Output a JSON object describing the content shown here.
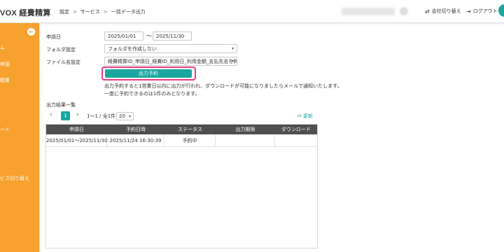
{
  "header": {
    "logo_text": "VOX",
    "logo_sub": "経費精算",
    "breadcrumbs": [
      "設定",
      "サービス",
      "一括データ出力"
    ],
    "breadcrumb_sep": ">",
    "switch_company": "会社切り替え",
    "logout": "ログアウト"
  },
  "sidebar": {
    "collapse_glyph": "←",
    "items": [
      "ム",
      "申請",
      "精算",
      "ート",
      "ビス切り替え"
    ]
  },
  "form": {
    "date_label": "申請日",
    "date_from": "2025/01/01",
    "date_to": "2025/11/30",
    "tilde": "〜",
    "folder_label": "フォルダ設定",
    "folder_value": "フォルダを作成しない",
    "filename_label": "ファイル名設定",
    "filename_value": "経費精算ID_申請日_経費ID_利用日_利用金額_支払先名を利用",
    "reserve_button": "出力予約",
    "note_line1": "出力予約すると1営業日以内に出力が行われ、ダウンロードが可能になりましたらメールで通知いたします。",
    "note_line2": "一度に予約できるのは1件のみとなります。"
  },
  "results": {
    "title": "出力結果一覧",
    "pager": {
      "prev": "‹",
      "current": "1",
      "next": "›",
      "summary": "1〜1 / 全1件",
      "page_size": "20"
    },
    "refresh": "更新",
    "columns": [
      "申請日",
      "予約日時",
      "ステータス",
      "出力期限",
      "ダウンロード"
    ],
    "rows": [
      {
        "period": "2025/01/01〜2025/11/30",
        "reserved_at": "2025/11/24 16:30:39",
        "status": "予約中",
        "deadline": "",
        "download": ""
      }
    ]
  },
  "colors": {
    "accent": "#1ba6a1",
    "sidebar": "#f7a12f",
    "highlight": "#e63b8a",
    "table_header": "#4f4f4f"
  }
}
